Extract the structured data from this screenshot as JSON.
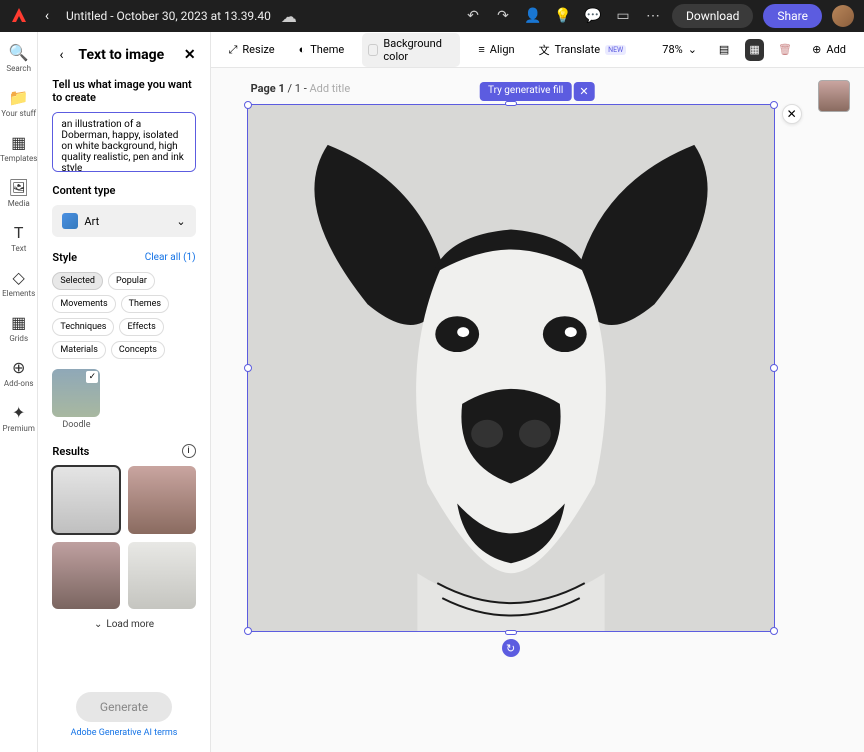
{
  "header": {
    "doc_title": "Untitled - October 30, 2023 at 13.39.40",
    "download": "Download",
    "share": "Share"
  },
  "rail": [
    {
      "icon": "🔍",
      "label": "Search"
    },
    {
      "icon": "📁",
      "label": "Your stuff"
    },
    {
      "icon": "▦",
      "label": "Templates"
    },
    {
      "icon": "🖼",
      "label": "Media"
    },
    {
      "icon": "T",
      "label": "Text"
    },
    {
      "icon": "◇",
      "label": "Elements"
    },
    {
      "icon": "▦",
      "label": "Grids"
    },
    {
      "icon": "⊕",
      "label": "Add-ons"
    },
    {
      "icon": "✦",
      "label": "Premium"
    }
  ],
  "sidepanel": {
    "title": "Text to image",
    "prompt_heading": "Tell us what image you want to create",
    "prompt_value": "an illustration of a Doberman, happy, isolated on white background, high quality realistic, pen and ink style",
    "content_type_heading": "Content type",
    "content_type_value": "Art",
    "style_heading": "Style",
    "clear_all": "Clear all (1)",
    "chips": [
      "Selected",
      "Popular",
      "Movements",
      "Themes",
      "Techniques",
      "Effects",
      "Materials",
      "Concepts"
    ],
    "style_thumb_label": "Doodle",
    "results_heading": "Results",
    "load_more": "Load more",
    "generate": "Generate",
    "terms": "Adobe Generative AI terms"
  },
  "toolbar": {
    "resize": "Resize",
    "theme": "Theme",
    "bgcolor": "Background color",
    "align": "Align",
    "translate": "Translate",
    "new_badge": "NEW",
    "zoom": "78%",
    "add": "Add"
  },
  "canvas": {
    "page_label_strong": "Page 1",
    "page_label_rest": " / 1 - ",
    "add_title": "Add title",
    "gen_fill": "Try generative fill",
    "gen_fill_close": "✕",
    "regen_glyph": "↻",
    "close_glyph": "✕"
  }
}
